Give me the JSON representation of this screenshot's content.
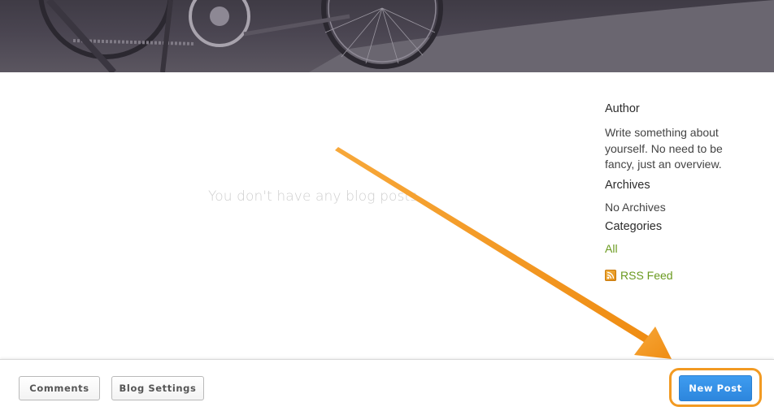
{
  "main": {
    "empty_message": "You don't have any blog posts"
  },
  "sidebar": {
    "author_heading": "Author",
    "author_text": "Write something about yourself. No need to be fancy, just an overview.",
    "archives_heading": "Archives",
    "archives_text": "No Archives",
    "categories_heading": "Categories",
    "category_all": "All",
    "rss_label": "RSS Feed"
  },
  "toolbar": {
    "comments_label": "Comments",
    "blog_settings_label": "Blog Settings",
    "new_post_label": "New Post"
  },
  "colors": {
    "link_green": "#6a9a1f",
    "new_post_blue": "#3e9cf0",
    "annotation_orange": "#f29a22"
  },
  "icons": {
    "rss": "rss-feed-icon",
    "annotation_arrow": "arrow-pointer-icon"
  }
}
